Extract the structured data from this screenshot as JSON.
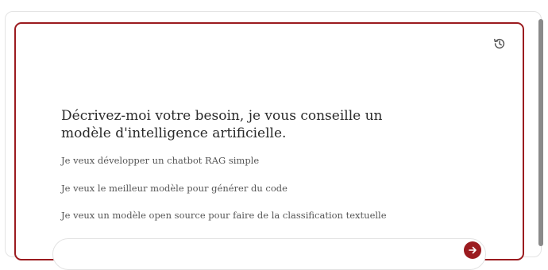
{
  "assistant": {
    "heading": "Décrivez-moi votre besoin, je vous conseille un modèle d'intelligence artificielle.",
    "suggestions": [
      "Je veux développer un chatbot RAG simple",
      "Je veux le meilleur modèle pour générer du code",
      "Je veux un modèle open source pour faire de la classification textuelle"
    ],
    "history_icon": "history-icon",
    "send_icon": "send-icon"
  },
  "colors": {
    "accent": "#9b1b1f",
    "heading_text": "#2a2a2a",
    "suggestion_text": "#555555"
  }
}
